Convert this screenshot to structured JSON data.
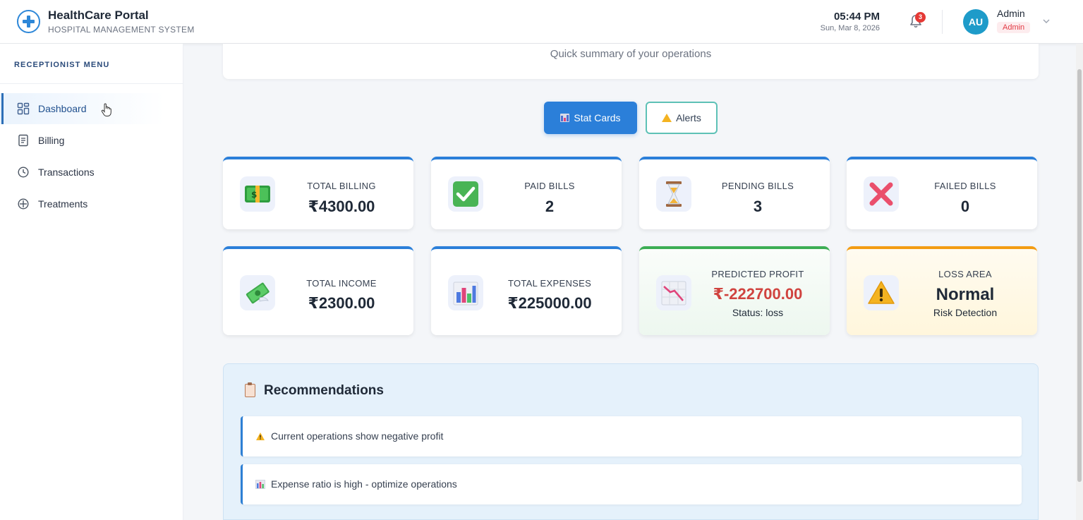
{
  "header": {
    "title": "HealthCare Portal",
    "subtitle": "HOSPITAL MANAGEMENT SYSTEM",
    "time": "05:44 PM",
    "date": "Sun, Mar 8, 2026",
    "notification_count": "3",
    "avatar_initials": "AU",
    "user_name": "Admin",
    "user_role": "Admin"
  },
  "sidebar": {
    "heading": "RECEPTIONIST MENU",
    "items": [
      {
        "label": "Dashboard",
        "icon": "grid-icon",
        "active": true
      },
      {
        "label": "Billing",
        "icon": "document-icon"
      },
      {
        "label": "Transactions",
        "icon": "clock-icon"
      },
      {
        "label": "Treatments",
        "icon": "plus-circle-icon"
      }
    ]
  },
  "main": {
    "summary_text": "Quick summary of your operations",
    "toggle": {
      "stat_cards_label": "Stat Cards",
      "alerts_label": "Alerts"
    },
    "cards": [
      {
        "label": "TOTAL BILLING",
        "value": "₹4300.00",
        "icon": "cash-icon"
      },
      {
        "label": "PAID BILLS",
        "value": "2",
        "icon": "check-icon"
      },
      {
        "label": "PENDING BILLS",
        "value": "3",
        "icon": "hourglass-icon"
      },
      {
        "label": "FAILED BILLS",
        "value": "0",
        "icon": "cross-icon"
      },
      {
        "label": "TOTAL INCOME",
        "value": "₹2300.00",
        "icon": "money-wings-icon"
      },
      {
        "label": "TOTAL EXPENSES",
        "value": "₹225000.00",
        "icon": "bar-chart-icon"
      },
      {
        "label": "PREDICTED PROFIT",
        "value": "₹-222700.00",
        "sub": "Status: loss",
        "icon": "trend-down-icon"
      },
      {
        "label": "LOSS AREA",
        "value": "Normal",
        "sub": "Risk Detection",
        "icon": "warning-icon"
      }
    ],
    "recommendations": {
      "title": "Recommendations",
      "items": [
        {
          "text": "Current operations show negative profit",
          "icon": "warning-icon"
        },
        {
          "text": "Expense ratio is high - optimize operations",
          "icon": "bar-chart-icon"
        }
      ]
    }
  },
  "colors": {
    "primary": "#2b7fd9",
    "accent_teal": "#5dc1b6",
    "loss_red": "#d0433f",
    "profit_green_border": "#3cad54",
    "loss_area_orange": "#f39c12"
  }
}
